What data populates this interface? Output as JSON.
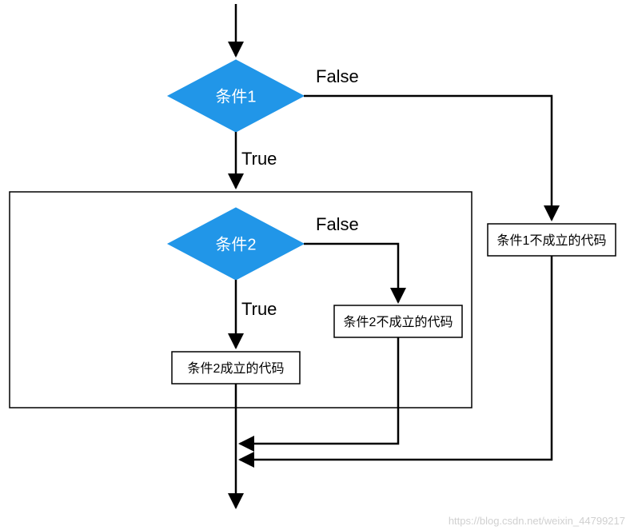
{
  "chart_data": {
    "type": "flowchart",
    "title": "",
    "nodes": [
      {
        "id": "cond1",
        "kind": "decision",
        "label": "条件1"
      },
      {
        "id": "cond2",
        "kind": "decision",
        "label": "条件2"
      },
      {
        "id": "cond2_true",
        "kind": "process",
        "label": "条件2成立的代码"
      },
      {
        "id": "cond2_false",
        "kind": "process",
        "label": "条件2不成立的代码"
      },
      {
        "id": "cond1_false",
        "kind": "process",
        "label": "条件1不成立的代码"
      }
    ],
    "edges": [
      {
        "from": "start",
        "to": "cond1",
        "label": ""
      },
      {
        "from": "cond1",
        "to": "cond2",
        "label": "True"
      },
      {
        "from": "cond1",
        "to": "cond1_false",
        "label": "False"
      },
      {
        "from": "cond2",
        "to": "cond2_true",
        "label": "True"
      },
      {
        "from": "cond2",
        "to": "cond2_false",
        "label": "False"
      },
      {
        "from": "cond2_true",
        "to": "end",
        "label": ""
      },
      {
        "from": "cond2_false",
        "to": "end",
        "label": ""
      },
      {
        "from": "cond1_false",
        "to": "end",
        "label": ""
      }
    ]
  },
  "labels": {
    "cond1": "条件1",
    "cond2": "条件2",
    "cond2_true": "条件2成立的代码",
    "cond2_false": "条件2不成立的代码",
    "cond1_false": "条件1不成立的代码",
    "true": "True",
    "false1": "False",
    "false2": "False"
  },
  "watermark": "https://blog.csdn.net/weixin_44799217"
}
